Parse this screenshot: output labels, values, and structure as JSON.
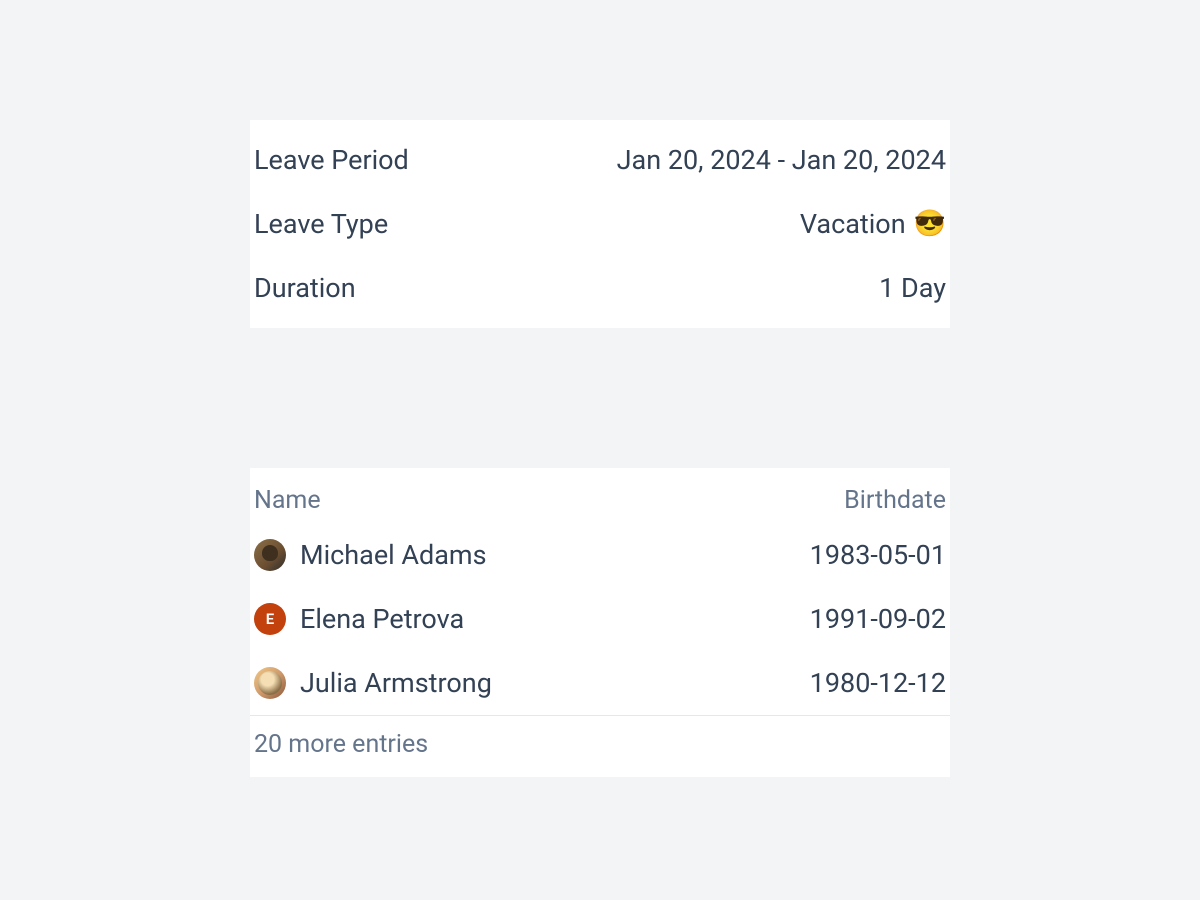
{
  "leave": {
    "period_label": "Leave Period",
    "period_value": "Jan 20, 2024 - Jan 20, 2024",
    "type_label": "Leave Type",
    "type_value": "Vacation",
    "type_emoji": "😎",
    "duration_label": "Duration",
    "duration_value": "1 Day"
  },
  "table": {
    "header_name": "Name",
    "header_birthdate": "Birthdate",
    "rows": [
      {
        "name": "Michael Adams",
        "birthdate": "1983-05-01",
        "avatar_letter": "",
        "avatar_class": "photo1"
      },
      {
        "name": "Elena Petrova",
        "birthdate": "1991-09-02",
        "avatar_letter": "E",
        "avatar_class": "letter-e"
      },
      {
        "name": "Julia Armstrong",
        "birthdate": "1980-12-12",
        "avatar_letter": "",
        "avatar_class": "photo3"
      }
    ],
    "footer": "20 more entries"
  }
}
